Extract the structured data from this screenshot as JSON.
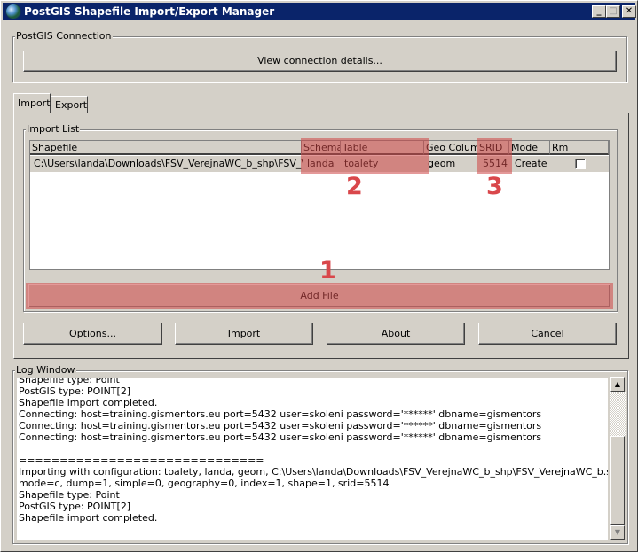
{
  "window": {
    "title": "PostGIS Shapefile Import/Export Manager",
    "controls": {
      "minimize": "_",
      "maximize": "□",
      "close": "✕"
    }
  },
  "connection": {
    "group_label": "PostGIS Connection",
    "view_details_label": "View connection details..."
  },
  "tabs": [
    {
      "label": "Import",
      "active": true
    },
    {
      "label": "Export",
      "active": false
    }
  ],
  "import_list": {
    "group_label": "Import List",
    "columns": [
      "Shapefile",
      "Schema",
      "Table",
      "Geo Column",
      "SRID",
      "Mode",
      "Rm"
    ],
    "rows": [
      {
        "shapefile": "C:\\Users\\landa\\Downloads\\FSV_VerejnaWC_b_shp\\FSV_VerejnaWC_b.shp",
        "schema": "landa",
        "table": "toalety",
        "geo_column": "geom",
        "srid": "5514",
        "mode": "Create",
        "rm": false
      }
    ],
    "add_file_label": "Add File"
  },
  "annotations": {
    "marker_1": "1",
    "marker_2": "2",
    "marker_3": "3",
    "highlight_color": "#d9474b"
  },
  "actions": {
    "options_label": "Options...",
    "import_label": "Import",
    "about_label": "About",
    "cancel_label": "Cancel"
  },
  "log": {
    "group_label": "Log Window",
    "lines": [
      "Shapefile type: Point",
      "PostGIS type: POINT[2]",
      "Shapefile import completed.",
      "Connecting:  host=training.gismentors.eu port=5432 user=skoleni password='******' dbname=gismentors",
      "Connecting:  host=training.gismentors.eu port=5432 user=skoleni password='******' dbname=gismentors",
      "Connecting:  host=training.gismentors.eu port=5432 user=skoleni password='******' dbname=gismentors",
      "",
      "==============================",
      "Importing with configuration: toalety, landa, geom, C:\\Users\\landa\\Downloads\\FSV_VerejnaWC_b_shp\\FSV_VerejnaWC_b.shp,",
      "mode=c, dump=1, simple=0, geography=0, index=1, shape=1, srid=5514",
      "Shapefile type: Point",
      "PostGIS type: POINT[2]",
      "Shapefile import completed."
    ]
  }
}
